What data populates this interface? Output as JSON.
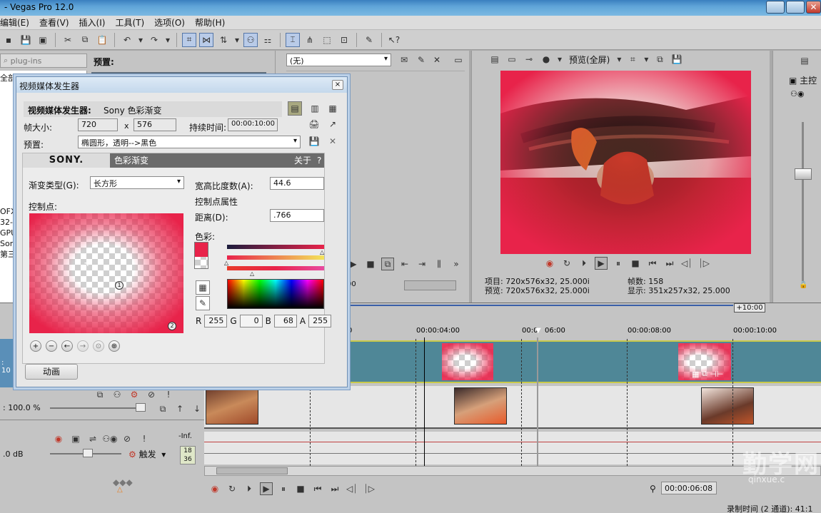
{
  "window": {
    "title": "- Vegas Pro 12.0"
  },
  "menu": [
    "编辑(E)",
    "查看(V)",
    "插入(I)",
    "工具(T)",
    "选项(O)",
    "帮助(H)"
  ],
  "plugin_panel": {
    "search": "plug-ins",
    "preset_header": "预置:",
    "tree": [
      "全部",
      "OFX",
      "32-",
      "GPU",
      "Son",
      "第三"
    ]
  },
  "fx_panel": {
    "preset_select": "(无)"
  },
  "preview": {
    "mode": "预览(全屏)",
    "info": {
      "project_label": "项目:",
      "project": "720x576x32, 25.000i",
      "preview_label": "预览:",
      "preview": "720x576x32, 25.000i",
      "frames_label": "帧数:",
      "frames": "158",
      "display_label": "显示:",
      "display": "351x257x32, 25.000"
    }
  },
  "mixer": {
    "label": "主控"
  },
  "dialog": {
    "title": "视频媒体发生器",
    "generator_label": "视频媒体发生器:",
    "generator_name": "Sony 色彩渐变",
    "frame_size_label": "帧大小:",
    "width": "720",
    "x": "x",
    "height": "576",
    "duration_label": "持续时间:",
    "duration": "00:00:10:00",
    "preset_label": "预置:",
    "preset_value": "椭圆形，透明-->黑色",
    "brand": "SONY.",
    "plugin_title": "色彩渐变",
    "about": "关于",
    "help": "?",
    "gradient_type_label": "渐变类型(G):",
    "gradient_type": "长方形",
    "control_points_label": "控制点:",
    "aspect_label": "宽高比度数(A):",
    "aspect": "44.6",
    "cp_props_label": "控制点属性",
    "distance_label": "距离(D):",
    "distance": ".766",
    "color_label": "色彩:",
    "r_label": "R",
    "r": "255",
    "g_label": "G",
    "g": "0",
    "b_label": "B",
    "b": "68",
    "a_label": "A",
    "a": "255",
    "point1": "1",
    "point2": "2",
    "animate_button": "动画"
  },
  "timeline": {
    "offset": "+10:00",
    "marks": [
      "0",
      "00:00:04:00",
      "00:0",
      "06:00",
      "00:00:08:00",
      "00:00:10:00"
    ],
    "track_left_value": ": 10",
    "video_level": ": 100.0 %",
    "audio_level": ".0 dB",
    "trigger_label": "触发",
    "inf": "-Inf.",
    "meter1": "18",
    "meter2": "36",
    "timecode": "00:00:06:08",
    "record_time": "录制时间 (2 通道): 41:1",
    "watermark_cn": "勤学网",
    "watermark_url": "qinxue.c"
  },
  "colors": {
    "accent": "#e8234a",
    "track_teal": "#4f8797",
    "selection": "#3a5fa8"
  }
}
